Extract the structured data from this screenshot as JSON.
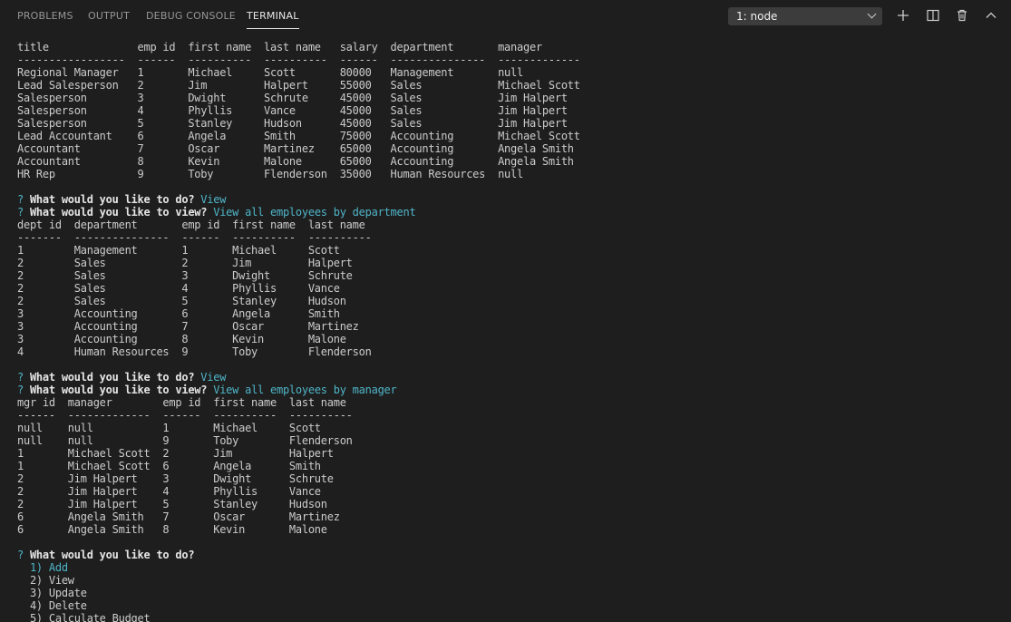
{
  "tabs": [
    {
      "label": "PROBLEMS"
    },
    {
      "label": "OUTPUT"
    },
    {
      "label": "DEBUG CONSOLE"
    },
    {
      "label": "TERMINAL"
    }
  ],
  "selector": {
    "value": "1: node"
  },
  "icons": {
    "add": "plus-icon",
    "split": "split-editor-icon",
    "kill": "trash-icon",
    "maximize": "chevron-up-icon"
  },
  "colors": {
    "accent": "#4fb5c8",
    "background": "#1e1e1e",
    "text": "#cccccc"
  },
  "terminal": {
    "lines": [
      {
        "segments": [
          {
            "text": "title              emp id  first name  last name   salary  department       manager"
          }
        ]
      },
      {
        "segments": [
          {
            "text": "-----------------  ------  ----------  ----------  ------  ---------------  -------------"
          }
        ]
      },
      {
        "segments": [
          {
            "text": "Regional Manager   1       Michael     Scott       80000   Management       null"
          }
        ]
      },
      {
        "segments": [
          {
            "text": "Lead Salesperson   2       Jim         Halpert     55000   Sales            Michael Scott"
          }
        ]
      },
      {
        "segments": [
          {
            "text": "Salesperson        3       Dwight      Schrute     45000   Sales            Jim Halpert"
          }
        ]
      },
      {
        "segments": [
          {
            "text": "Salesperson        4       Phyllis     Vance       45000   Sales            Jim Halpert"
          }
        ]
      },
      {
        "segments": [
          {
            "text": "Salesperson        5       Stanley     Hudson      45000   Sales            Jim Halpert"
          }
        ]
      },
      {
        "segments": [
          {
            "text": "Lead Accountant    6       Angela      Smith       75000   Accounting       Michael Scott"
          }
        ]
      },
      {
        "segments": [
          {
            "text": "Accountant         7       Oscar       Martinez    65000   Accounting       Angela Smith"
          }
        ]
      },
      {
        "segments": [
          {
            "text": "Accountant         8       Kevin       Malone      65000   Accounting       Angela Smith"
          }
        ]
      },
      {
        "segments": [
          {
            "text": "HR Rep             9       Toby        Flenderson  35000   Human Resources  null"
          }
        ]
      },
      {
        "segments": [
          {
            "text": ""
          }
        ]
      },
      {
        "segments": [
          {
            "text": "? ",
            "style": "q"
          },
          {
            "text": "What would you like to do?",
            "style": "b"
          },
          {
            "text": " View",
            "style": "ans"
          }
        ]
      },
      {
        "segments": [
          {
            "text": "? ",
            "style": "q"
          },
          {
            "text": "What would you like to view?",
            "style": "b"
          },
          {
            "text": " View all employees by department",
            "style": "ans"
          }
        ]
      },
      {
        "segments": [
          {
            "text": "dept id  department       emp id  first name  last name"
          }
        ]
      },
      {
        "segments": [
          {
            "text": "-------  ---------------  ------  ----------  ----------"
          }
        ]
      },
      {
        "segments": [
          {
            "text": "1        Management       1       Michael     Scott"
          }
        ]
      },
      {
        "segments": [
          {
            "text": "2        Sales            2       Jim         Halpert"
          }
        ]
      },
      {
        "segments": [
          {
            "text": "2        Sales            3       Dwight      Schrute"
          }
        ]
      },
      {
        "segments": [
          {
            "text": "2        Sales            4       Phyllis     Vance"
          }
        ]
      },
      {
        "segments": [
          {
            "text": "2        Sales            5       Stanley     Hudson"
          }
        ]
      },
      {
        "segments": [
          {
            "text": "3        Accounting       6       Angela      Smith"
          }
        ]
      },
      {
        "segments": [
          {
            "text": "3        Accounting       7       Oscar       Martinez"
          }
        ]
      },
      {
        "segments": [
          {
            "text": "3        Accounting       8       Kevin       Malone"
          }
        ]
      },
      {
        "segments": [
          {
            "text": "4        Human Resources  9       Toby        Flenderson"
          }
        ]
      },
      {
        "segments": [
          {
            "text": ""
          }
        ]
      },
      {
        "segments": [
          {
            "text": "? ",
            "style": "q"
          },
          {
            "text": "What would you like to do?",
            "style": "b"
          },
          {
            "text": " View",
            "style": "ans"
          }
        ]
      },
      {
        "segments": [
          {
            "text": "? ",
            "style": "q"
          },
          {
            "text": "What would you like to view?",
            "style": "b"
          },
          {
            "text": " View all employees by manager",
            "style": "ans"
          }
        ]
      },
      {
        "segments": [
          {
            "text": "mgr id  manager        emp id  first name  last name"
          }
        ]
      },
      {
        "segments": [
          {
            "text": "------  -------------  ------  ----------  ----------"
          }
        ]
      },
      {
        "segments": [
          {
            "text": "null    null           1       Michael     Scott"
          }
        ]
      },
      {
        "segments": [
          {
            "text": "null    null           9       Toby        Flenderson"
          }
        ]
      },
      {
        "segments": [
          {
            "text": "1       Michael Scott  2       Jim         Halpert"
          }
        ]
      },
      {
        "segments": [
          {
            "text": "1       Michael Scott  6       Angela      Smith"
          }
        ]
      },
      {
        "segments": [
          {
            "text": "2       Jim Halpert    3       Dwight      Schrute"
          }
        ]
      },
      {
        "segments": [
          {
            "text": "2       Jim Halpert    4       Phyllis     Vance"
          }
        ]
      },
      {
        "segments": [
          {
            "text": "2       Jim Halpert    5       Stanley     Hudson"
          }
        ]
      },
      {
        "segments": [
          {
            "text": "6       Angela Smith   7       Oscar       Martinez"
          }
        ]
      },
      {
        "segments": [
          {
            "text": "6       Angela Smith   8       Kevin       Malone"
          }
        ]
      },
      {
        "segments": [
          {
            "text": ""
          }
        ]
      },
      {
        "segments": [
          {
            "text": "? ",
            "style": "q"
          },
          {
            "text": "What would you like to do?",
            "style": "b"
          }
        ]
      },
      {
        "segments": [
          {
            "text": "  1) Add",
            "style": "ans"
          }
        ]
      },
      {
        "segments": [
          {
            "text": "  2) View"
          }
        ]
      },
      {
        "segments": [
          {
            "text": "  3) Update"
          }
        ]
      },
      {
        "segments": [
          {
            "text": "  4) Delete"
          }
        ]
      },
      {
        "segments": [
          {
            "text": "  5) Calculate Budget"
          }
        ]
      }
    ]
  }
}
